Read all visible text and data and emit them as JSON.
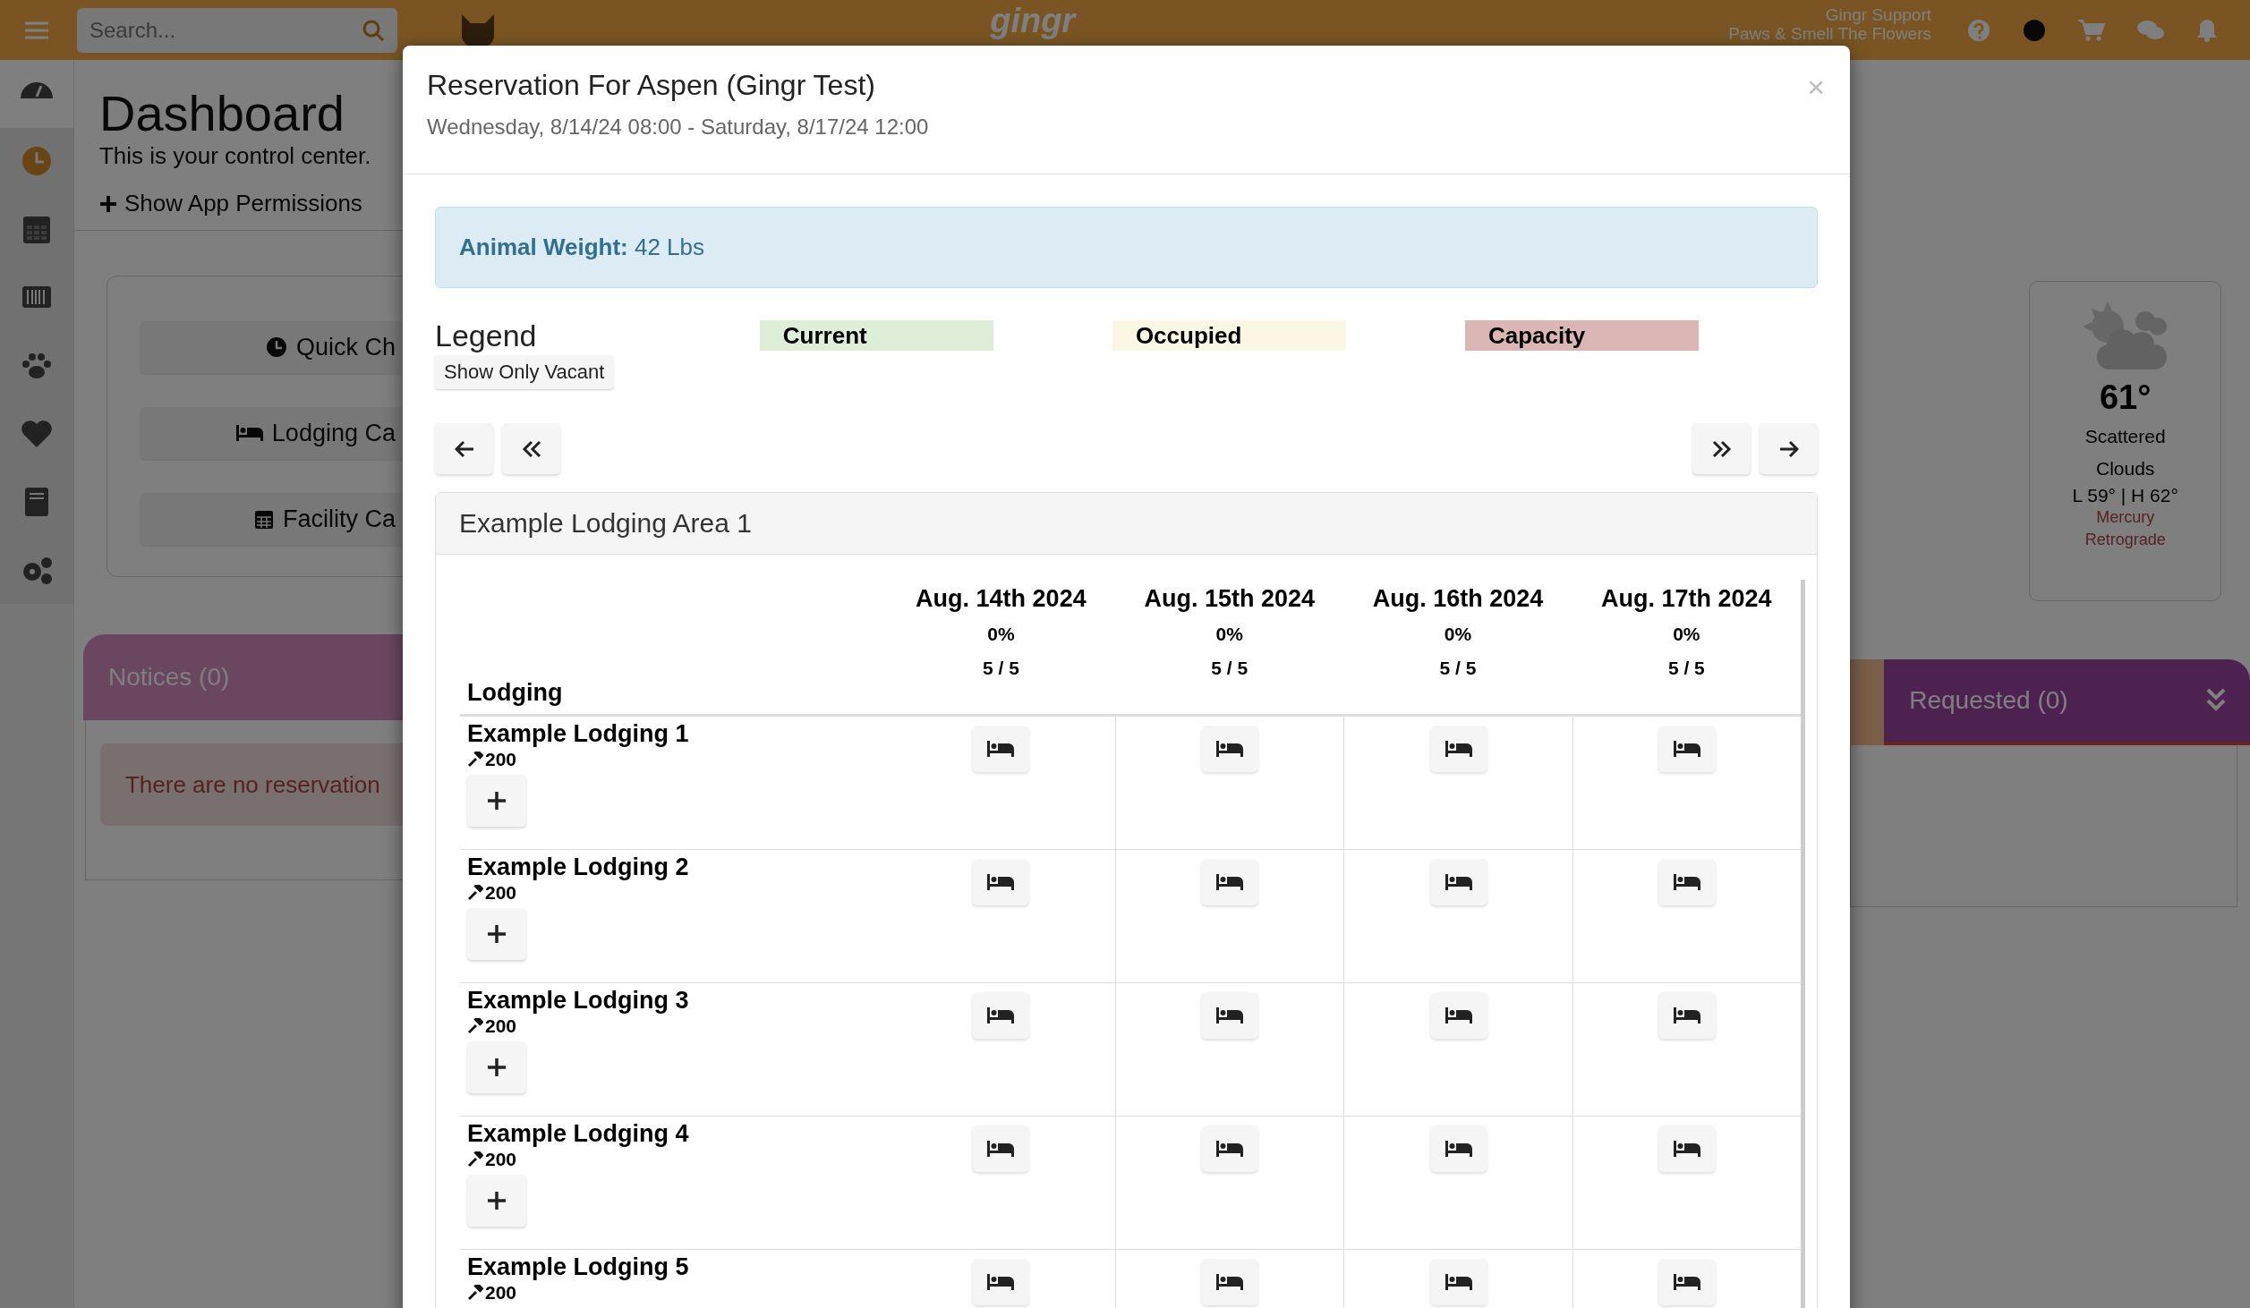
{
  "topbar": {
    "search": {
      "placeholder": "Search..."
    },
    "logo": "gingr",
    "user": {
      "name": "Gingr Support",
      "subtitle": "Paws & Smell The Flowers"
    }
  },
  "sidebar": {
    "items": [
      {
        "selected": true
      },
      {
        "selected": false
      },
      {
        "selected": false
      },
      {
        "selected": false
      },
      {
        "selected": false
      },
      {
        "selected": false
      },
      {
        "selected": false
      },
      {
        "selected": false
      }
    ]
  },
  "dashboard": {
    "title": "Dashboard",
    "subtitle": "This is your control center.",
    "permissions_link": "Show App Permissions",
    "quick_buttons": [
      "Quick Ch",
      "Lodging Ca",
      "Facility Ca"
    ]
  },
  "notices": {
    "title": "Notices (0)",
    "message": "There are no reservation"
  },
  "weather": {
    "temperature": "61°",
    "condition": "Scattered Clouds",
    "range": "L 59° | H 62°",
    "note": "Mercury Retrograde"
  },
  "requested": {
    "title": "Requested (0)"
  },
  "modal": {
    "title": "Reservation For Aspen (Gingr Test)",
    "subtitle": "Wednesday, 8/14/24 08:00 - Saturday, 8/17/24 12:00",
    "close": "×",
    "alert": "**Animal Weight:** 42 Lbs",
    "legend": {
      "title": "Legend",
      "button": "Show Only Vacant",
      "items": [
        {
          "label": "Current",
          "color": "#dfeed8"
        },
        {
          "label": "Occupied",
          "color": "#fcf6e5"
        },
        {
          "label": "Capacity",
          "color": "#dbb6b4"
        }
      ]
    },
    "area": {
      "title": "Example Lodging Area 1",
      "lodging_header": "Lodging",
      "columns": [
        {
          "date": "Aug. 14th 2024",
          "percent": "0%",
          "count": "5 / 5"
        },
        {
          "date": "Aug. 15th 2024",
          "percent": "0%",
          "count": "5 / 5"
        },
        {
          "date": "Aug. 16th 2024",
          "percent": "0%",
          "count": "5 / 5"
        },
        {
          "date": "Aug. 17th 2024",
          "percent": "0%",
          "count": "5 / 5"
        }
      ],
      "rows": [
        {
          "name": "Example Lodging 1",
          "price": "200"
        },
        {
          "name": "Example Lodging 2",
          "price": "200"
        },
        {
          "name": "Example Lodging 3",
          "price": "200"
        },
        {
          "name": "Example Lodging 4",
          "price": "200"
        },
        {
          "name": "Example Lodging 5",
          "price": "200"
        }
      ]
    }
  }
}
